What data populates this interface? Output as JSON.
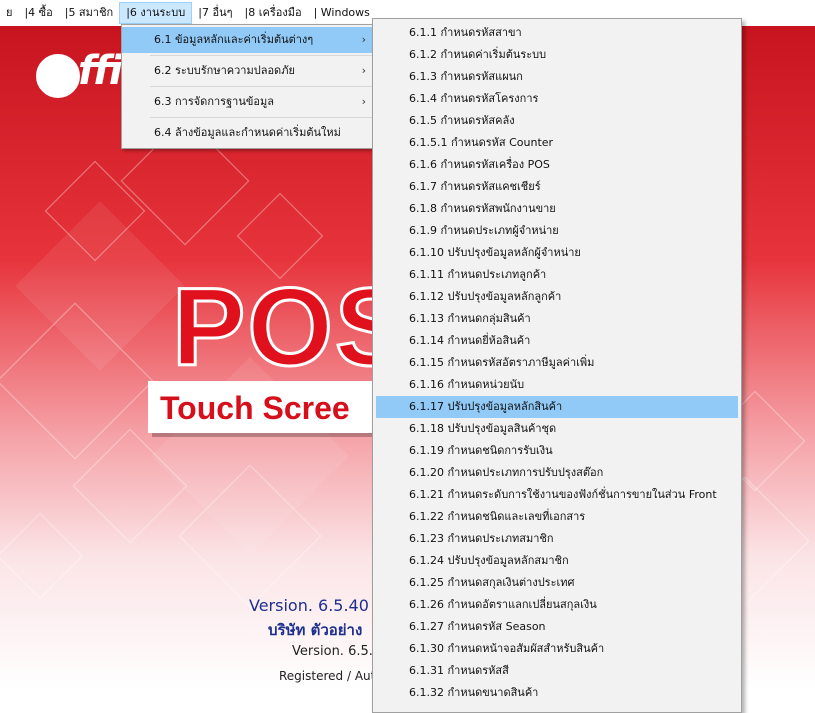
{
  "menubar": {
    "items": [
      {
        "label": "ย"
      },
      {
        "label": "|4 ซื้อ"
      },
      {
        "label": "|5 สมาชิก"
      },
      {
        "label": "|6 งานระบบ"
      },
      {
        "label": "|7 อื่นๆ"
      },
      {
        "label": "|8 เครื่องมือ"
      },
      {
        "label": "| Windows"
      }
    ],
    "active_index": 3
  },
  "splash": {
    "logo_text": "ffi",
    "pos_title": "POS",
    "touch_text": "Touch Scree",
    "version_main": "Version. 6.5.40",
    "company": "บริษัท ตัวอย่าง",
    "version_sub": "Version. 6.5.",
    "registered": "Registered / Aut"
  },
  "menu1": {
    "items": [
      {
        "label": "6.1 ข้อมูลหลักและค่าเริ่มต้นต่างๆ",
        "arrow": "›",
        "highlighted": true
      },
      {
        "label": "6.2 ระบบรักษาความปลอดภัย",
        "arrow": "›"
      },
      {
        "label": "6.3 การจัดการฐานข้อมูล",
        "arrow": "›"
      },
      {
        "label": "6.4 ล้างข้อมูลและกำหนดค่าเริ่มต้นใหม่",
        "arrow": ""
      }
    ]
  },
  "submenu": {
    "items": [
      "6.1.1 กำหนดรหัสสาขา",
      "6.1.2 กำหนดค่าเริ่มต้นระบบ",
      "6.1.3 กำหนดรหัสแผนก",
      "6.1.4 กำหนดรหัสโครงการ",
      "6.1.5 กำหนดรหัสคลัง",
      "6.1.5.1 กำหนดรหัส Counter",
      "6.1.6 กำหนดรหัสเครื่อง POS",
      "6.1.7 กำหนดรหัสแคชเชียร์",
      "6.1.8 กำหนดรหัสพนักงานขาย",
      "6.1.9 กำหนดประเภทผู้จำหน่าย",
      "6.1.10 ปรับปรุงข้อมูลหลักผู้จำหน่าย",
      "6.1.11 กำหนดประเภทลูกค้า",
      "6.1.12 ปรับปรุงข้อมูลหลักลูกค้า",
      "6.1.13 กำหนดกลุ่มสินค้า",
      "6.1.14 กำหนดยี่ห้อสินค้า",
      "6.1.15 กำหนดรหัสอัตราภาษีมูลค่าเพิ่ม",
      "6.1.16 กำหนดหน่วยนับ",
      "6.1.17 ปรับปรุงข้อมูลหลักสินค้า",
      "6.1.18 ปรับปรุงข้อมูลสินค้าชุด",
      "6.1.19 กำหนดชนิดการรับเงิน",
      "6.1.20 กำหนดประเภทการปรับปรุงสต๊อก",
      "6.1.21 กำหนดระดับการใช้งานของฟังก์ชั่นการขายในส่วน Front",
      "6.1.22 กำหนดชนิดและเลขที่เอกสาร",
      "6.1.23 กำหนดประเภทสมาชิก",
      "6.1.24 ปรับปรุงข้อมูลหลักสมาชิก",
      "6.1.25 กำหนดสกุลเงินต่างประเทศ",
      "6.1.26 กำหนดอัตราแลกเปลี่ยนสกุลเงิน",
      "6.1.27 กำหนดรหัส Season",
      "6.1.30 กำหนดหน้าจอสัมผัสสำหรับสินค้า",
      "6.1.31 กำหนดรหัสสี",
      "6.1.32 กำหนดขนาดสินค้า"
    ],
    "highlighted_index": 17
  },
  "colors": {
    "highlight": "#91c9f7",
    "menu_bg": "#f2f2f2",
    "brand_red": "#e0101c",
    "version_blue": "#1d2f8f"
  }
}
